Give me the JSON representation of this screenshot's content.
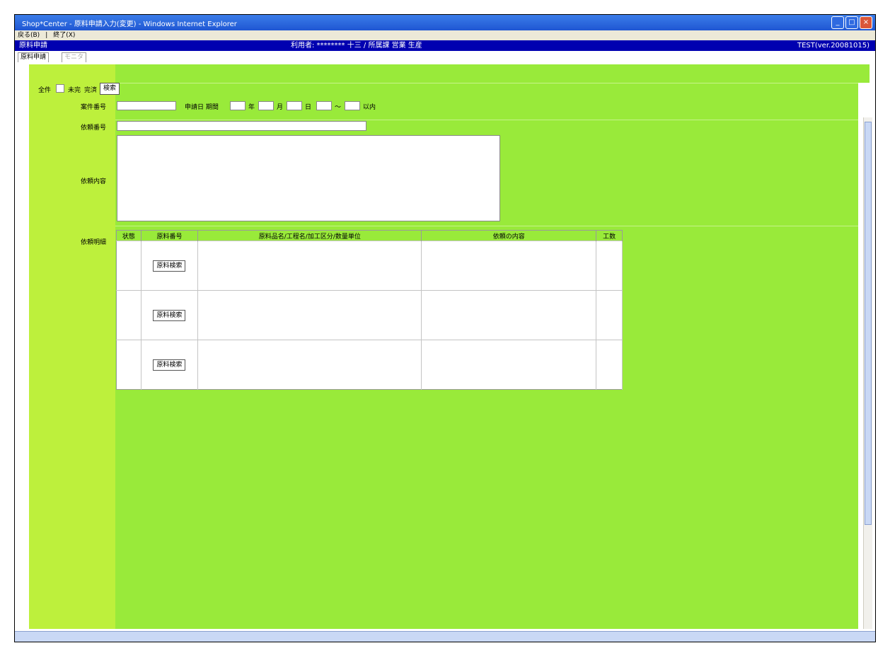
{
  "window": {
    "title": "Shop*Center - 原料申請入力(変更) - Windows Internet Explorer",
    "controls": [
      "_",
      "□",
      "×"
    ]
  },
  "menu": [
    "戻る(B)",
    "|",
    "終了(X)"
  ],
  "header": {
    "left": "原料申請",
    "center": "利用者: ******** 十三 / 所属課 営業 生産",
    "right": "TEST(ver.20081015)"
  },
  "tabs": {
    "active": "原料申請",
    "inactive": "モニタ"
  },
  "filters": {
    "radio_1_label": "全件",
    "radio_2_label": "未完",
    "radio_3_label": "完済",
    "search_button": "検索"
  },
  "fields": {
    "case_no_label": "案件番号",
    "date_label": "申請日 期間",
    "year_label": "年",
    "month_label": "月",
    "day_label": "日",
    "to_label": "〜",
    "until_label": "以内",
    "request_no_label": "依頼番号",
    "request_content_label": "依頼内容",
    "request_items_label": "依頼明細"
  },
  "table": {
    "headers": [
      "状態",
      "原料番号",
      "原料品名/工程名/加工区分/数量単位",
      "依頼の内容",
      "工数"
    ],
    "button_label": "原料検索",
    "row_count": 3
  }
}
